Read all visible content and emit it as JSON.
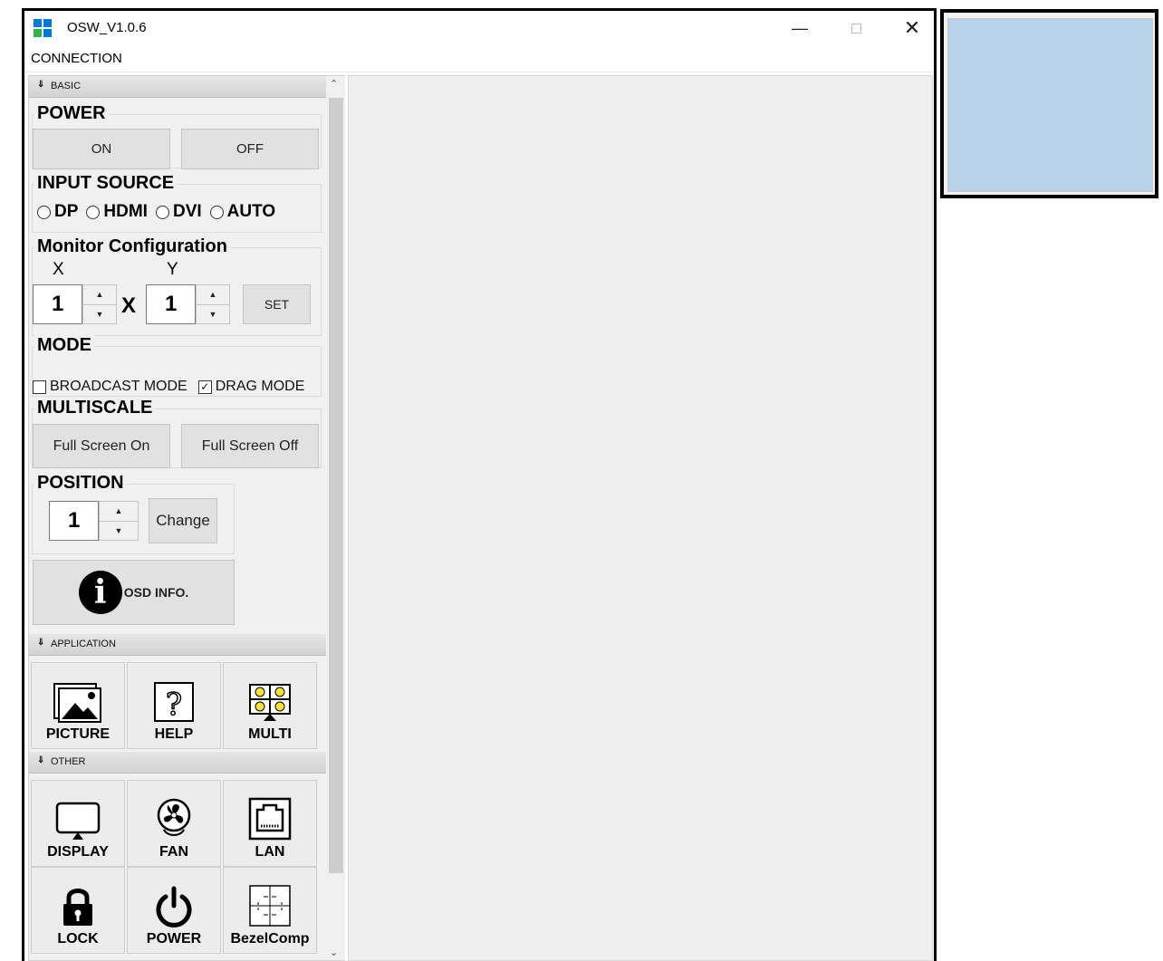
{
  "window": {
    "title": "OSW_V1.0.6",
    "logo_colors": [
      "#0078d7",
      "#0078d7",
      "#2fb24c",
      "#0078d7"
    ],
    "minimize_icon": "minimize-icon",
    "maximize_icon": "maximize-icon",
    "close_icon": "close-icon"
  },
  "menu": {
    "connection": "CONNECTION"
  },
  "sections": {
    "basic": "BASIC",
    "application": "APPLICATION",
    "other": "OTHER"
  },
  "power": {
    "title": "POWER",
    "on_label": "ON",
    "off_label": "OFF"
  },
  "input_source": {
    "title": "INPUT SOURCE",
    "options": [
      "DP",
      "HDMI",
      "DVI",
      "AUTO"
    ]
  },
  "monitor_config": {
    "title": "Monitor Configuration",
    "x_label": "X",
    "y_label": "Y",
    "x_value": "1",
    "y_value": "1",
    "times": "X",
    "set_label": "SET"
  },
  "mode": {
    "title": "MODE",
    "broadcast_label": "BROADCAST MODE",
    "broadcast_checked": false,
    "drag_label": "DRAG MODE",
    "drag_checked": true
  },
  "multiscale": {
    "title": "MULTISCALE",
    "on_label": "Full Screen On",
    "off_label": "Full Screen Off"
  },
  "position": {
    "title": "POSITION",
    "value": "1",
    "change_label": "Change"
  },
  "osd": {
    "label": "OSD INFO."
  },
  "application_tiles": [
    {
      "label": "PICTURE",
      "icon": "picture-icon"
    },
    {
      "label": "HELP",
      "icon": "help-icon"
    },
    {
      "label": "MULTI",
      "icon": "multi-icon"
    }
  ],
  "other_tiles": [
    {
      "label": "DISPLAY",
      "icon": "display-icon"
    },
    {
      "label": "FAN",
      "icon": "fan-icon"
    },
    {
      "label": "LAN",
      "icon": "lan-icon"
    },
    {
      "label": "LOCK",
      "icon": "lock-icon"
    },
    {
      "label": "POWER",
      "icon": "power-icon"
    },
    {
      "label": "BezelComp",
      "icon": "bezel-comp-icon"
    }
  ],
  "preview": {
    "fill_color": "#bad1ea"
  }
}
